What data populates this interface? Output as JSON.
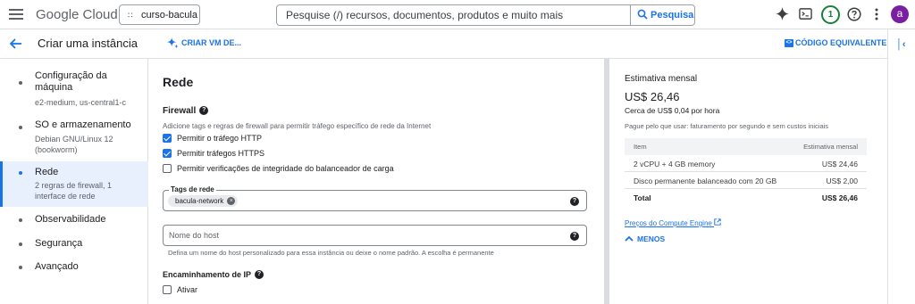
{
  "topbar": {
    "logo": {
      "google": "Google",
      "cloud": "Cloud"
    },
    "project": "curso-bacula",
    "search": {
      "placeholder": "Pesquise (/) recursos, documentos, produtos e muito mais",
      "button": "Pesquisa"
    },
    "notifications_count": "1",
    "avatar_letter": "a"
  },
  "header": {
    "title": "Criar uma instância",
    "create_vm_label": "CRIAR VM DE...",
    "code_equiv_label": "CÓDIGO EQUIVALENTE"
  },
  "sidebar": {
    "items": [
      {
        "label": "Configuração da máquina",
        "sub": "e2-medium, us-central1-c"
      },
      {
        "label": "SO e armazenamento",
        "sub": "Debian GNU/Linux 12 (bookworm)"
      },
      {
        "label": "Rede",
        "sub": "2 regras de firewall, 1 interface de rede",
        "active": true
      },
      {
        "label": "Observabilidade"
      },
      {
        "label": "Segurança"
      },
      {
        "label": "Avançado"
      }
    ]
  },
  "main": {
    "heading": "Rede",
    "firewall": {
      "title": "Firewall",
      "description": "Adicione tags e regras de firewall para permitir tráfego específico de rede da Internet",
      "options": [
        {
          "label": "Permitir o tráfego HTTP",
          "checked": true
        },
        {
          "label": "Permitir tráfegos HTTPS",
          "checked": true
        },
        {
          "label": "Permitir verificações de integridade do balanceador de carga",
          "checked": false
        }
      ]
    },
    "network_tags": {
      "label": "Tags de rede",
      "chips": [
        "bacula-network"
      ]
    },
    "hostname": {
      "placeholder": "Nome do host",
      "hint": "Defina um nome do host personalizado para essa instância ou deixe o nome padrão. A escolha é permanente"
    },
    "ip_forwarding": {
      "title": "Encaminhamento de IP",
      "option": "Ativar"
    }
  },
  "estimate": {
    "title": "Estimativa mensal",
    "price": "US$ 26,46",
    "hourly": "Cerca de US$ 0,04 por hora",
    "pay_note": "Pague pelo que usar: faturamento por segundo e sem custos iniciais",
    "table": {
      "headers": [
        "Item",
        "Estimativa mensal"
      ],
      "rows": [
        [
          "2 vCPU + 4 GB memory",
          "US$ 24,46"
        ],
        [
          "Disco permanente balanceado com 20 GB",
          "US$ 2,00"
        ],
        [
          "Total",
          "US$ 26,46"
        ]
      ]
    },
    "pricing_link": "Preços do Compute Engine",
    "less_label": "MENOS"
  },
  "colors": {
    "accent": "#1a73e8",
    "active_bg": "#e8f0fe",
    "avatar": "#7b1fa2",
    "notif": "#188038"
  }
}
